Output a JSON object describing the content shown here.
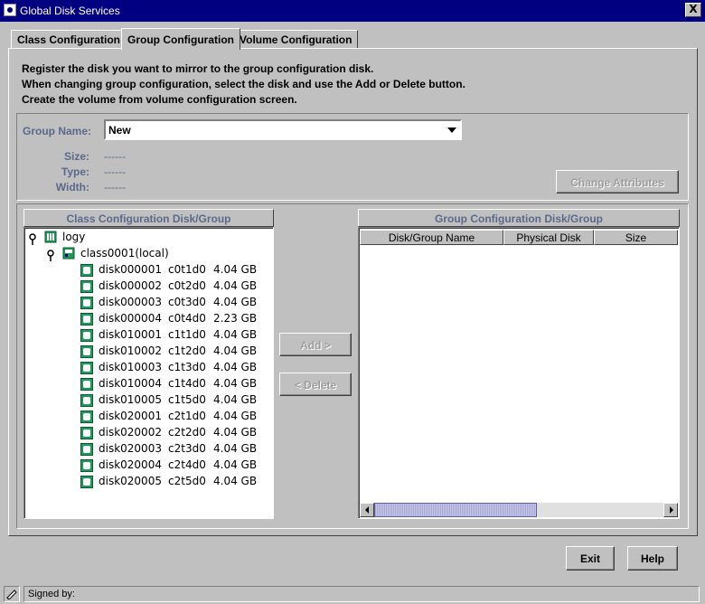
{
  "window": {
    "title": "Global Disk Services",
    "close_label": "X"
  },
  "tabs": [
    {
      "label": "Class Configuration"
    },
    {
      "label": "Group Configuration"
    },
    {
      "label": "Volume Configuration"
    }
  ],
  "instructions": [
    "Register the disk you want to mirror to the group configuration disk.",
    "When changing group configuration, select the disk and use the Add or Delete button.",
    "Create the volume from volume configuration screen."
  ],
  "group": {
    "name_label": "Group Name:",
    "name_value": "New",
    "size_label": "Size:",
    "size_value": "------",
    "type_label": "Type:",
    "type_value": "------",
    "width_label": "Width:",
    "width_value": "------",
    "change_attributes_label": "Change Attributes"
  },
  "left_panel": {
    "title": "Class Configuration Disk/Group",
    "root": "logy",
    "class": "class0001(local)",
    "disks": [
      {
        "name": "disk000001",
        "physical": "c0t1d0",
        "size": "4.04 GB"
      },
      {
        "name": "disk000002",
        "physical": "c0t2d0",
        "size": "4.04 GB"
      },
      {
        "name": "disk000003",
        "physical": "c0t3d0",
        "size": "4.04 GB"
      },
      {
        "name": "disk000004",
        "physical": "c0t4d0",
        "size": "2.23 GB"
      },
      {
        "name": "disk010001",
        "physical": "c1t1d0",
        "size": "4.04 GB"
      },
      {
        "name": "disk010002",
        "physical": "c1t2d0",
        "size": "4.04 GB"
      },
      {
        "name": "disk010003",
        "physical": "c1t3d0",
        "size": "4.04 GB"
      },
      {
        "name": "disk010004",
        "physical": "c1t4d0",
        "size": "4.04 GB"
      },
      {
        "name": "disk010005",
        "physical": "c1t5d0",
        "size": "4.04 GB"
      },
      {
        "name": "disk020001",
        "physical": "c2t1d0",
        "size": "4.04 GB"
      },
      {
        "name": "disk020002",
        "physical": "c2t2d0",
        "size": "4.04 GB"
      },
      {
        "name": "disk020003",
        "physical": "c2t3d0",
        "size": "4.04 GB"
      },
      {
        "name": "disk020004",
        "physical": "c2t4d0",
        "size": "4.04 GB"
      },
      {
        "name": "disk020005",
        "physical": "c2t5d0",
        "size": "4.04 GB"
      }
    ]
  },
  "middle": {
    "add_label": "Add >",
    "delete_label": "< Delete"
  },
  "right_panel": {
    "title": "Group Configuration Disk/Group",
    "columns": [
      "Disk/Group Name",
      "Physical Disk",
      "Size"
    ]
  },
  "footer": {
    "exit_label": "Exit",
    "help_label": "Help"
  },
  "status": {
    "text": "Signed by:"
  }
}
